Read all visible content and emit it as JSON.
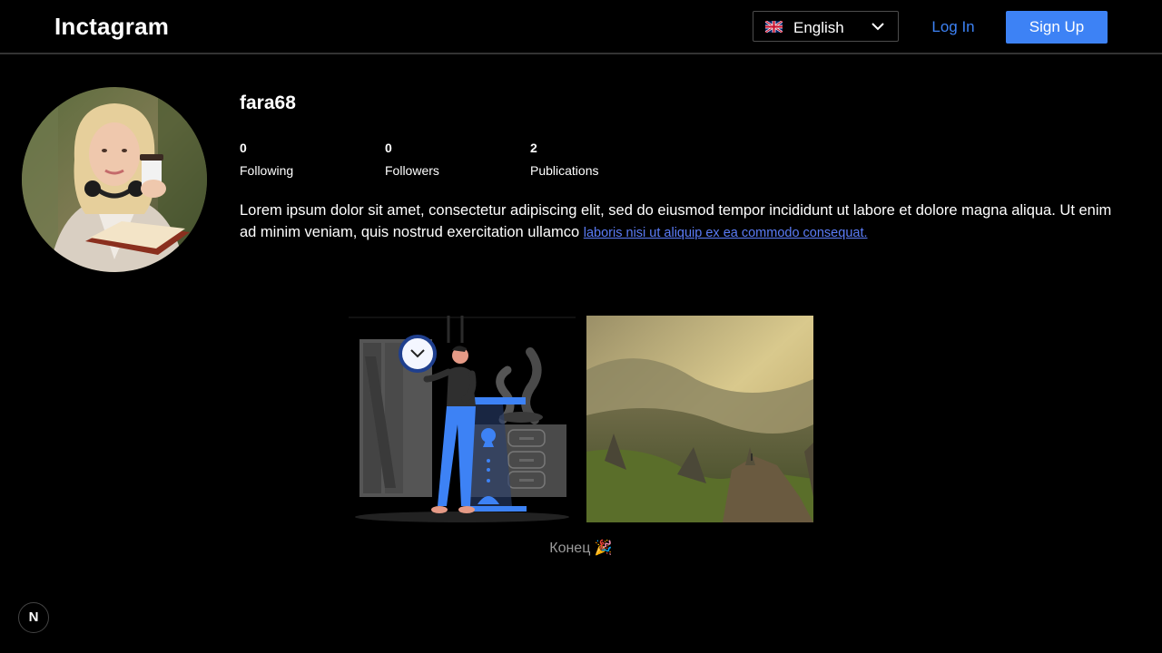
{
  "header": {
    "logo": "Inctagram",
    "language": {
      "selected": "English",
      "flag_icon": "uk-flag-icon"
    },
    "login_label": "Log In",
    "signup_label": "Sign Up"
  },
  "profile": {
    "username": "fara68",
    "stats": [
      {
        "value": "0",
        "label": "Following"
      },
      {
        "value": "0",
        "label": "Followers"
      },
      {
        "value": "2",
        "label": "Publications"
      }
    ],
    "bio_text": "Lorem ipsum dolor sit amet, consectetur adipiscing elit, sed do eiusmod tempor incididunt ut labore et dolore magna aliqua. Ut enim ad minim veniam, quis nostrud exercitation ullamco",
    "bio_link": "laboris nisi ut aliquip ex ea commodo consequat."
  },
  "posts_end": "Конец 🎉",
  "dev_badge": "N",
  "colors": {
    "accent": "#3d82f5",
    "link": "#5b7cf7",
    "background": "#000000"
  }
}
